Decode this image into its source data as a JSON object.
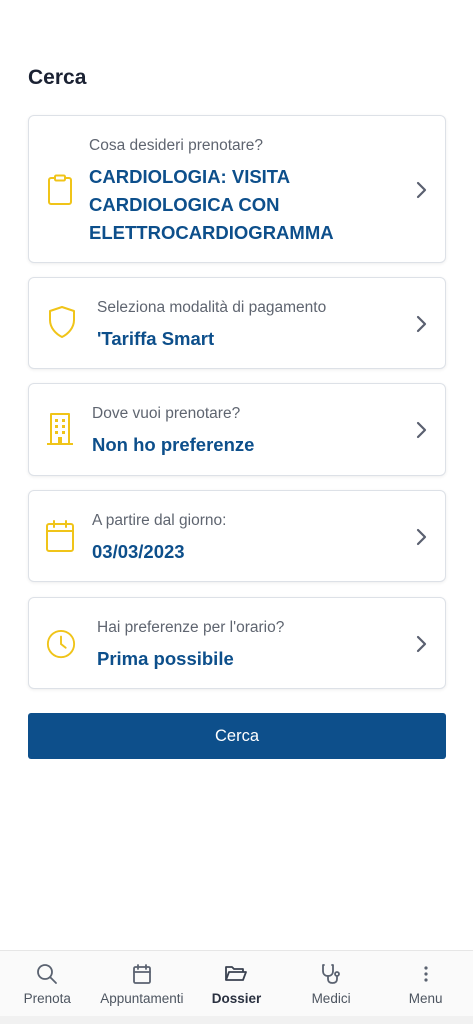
{
  "page": {
    "title": "Cerca"
  },
  "cards": [
    {
      "label": "Cosa desideri prenotare?",
      "value_lines": [
        "CARDIOLOGIA: VISITA",
        "CARDIOLOGICA CON",
        "ELETTROCARDIOGRAMMA"
      ],
      "icon": "clipboard-icon"
    },
    {
      "label": "Seleziona modalità di pagamento",
      "value": "'Tariffa Smart",
      "icon": "shield-icon"
    },
    {
      "label": "Dove vuoi prenotare?",
      "value": "Non ho preferenze",
      "icon": "building-icon"
    },
    {
      "label": "A partire dal giorno:",
      "value": "03/03/2023",
      "icon": "calendar-icon"
    },
    {
      "label": "Hai preferenze per l'orario?",
      "value": "Prima possibile",
      "icon": "clock-icon"
    }
  ],
  "search_button": {
    "label": "Cerca"
  },
  "bottom_nav": [
    {
      "label": "Prenota",
      "icon": "search-icon",
      "active": false
    },
    {
      "label": "Appuntamenti",
      "icon": "calendar-icon",
      "active": false
    },
    {
      "label": "Dossier",
      "icon": "folder-open-icon",
      "active": true
    },
    {
      "label": "Medici",
      "icon": "stethoscope-icon",
      "active": false
    },
    {
      "label": "Menu",
      "icon": "more-vertical-icon",
      "active": false
    }
  ],
  "colors": {
    "accent": "#0d4f8b",
    "icon_yellow": "#f0c419",
    "label_gray": "#5f6570"
  }
}
